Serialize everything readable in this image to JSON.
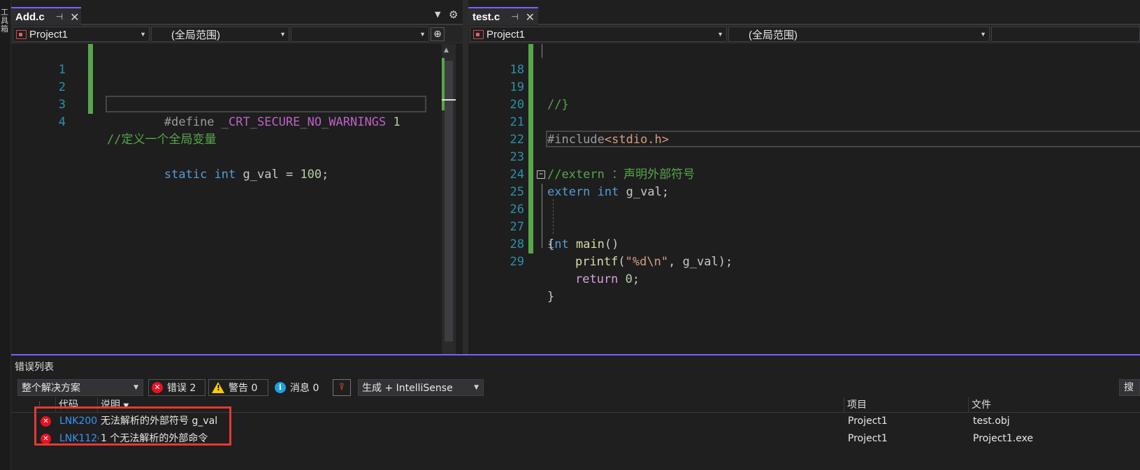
{
  "left_rail": {
    "text": "工具箱"
  },
  "left_editor": {
    "tab": {
      "title": "Add.c",
      "pin": "⊣",
      "close": "✕"
    },
    "nav": {
      "project": "Project1",
      "scope": "(全局范围)",
      "member": ""
    },
    "lines": [
      {
        "num": "1"
      },
      {
        "num": "2"
      },
      {
        "num": "3"
      },
      {
        "num": "4"
      }
    ],
    "code": {
      "l1_directive": "#define",
      "l1_macro": "_CRT_SECURE_NO_WARNINGS",
      "l1_value": "1",
      "l3_comment": "//定义一个全局变量",
      "l4_static": "static",
      "l4_int": "int",
      "l4_rest": "g_val =",
      "l4_num": "100",
      "l4_end": ";"
    }
  },
  "right_editor": {
    "tab": {
      "title": "test.c",
      "pin": "⊣",
      "close": "✕"
    },
    "nav": {
      "project": "Project1",
      "scope": "(全局范围)"
    },
    "lines": [
      {
        "num": "18"
      },
      {
        "num": "19"
      },
      {
        "num": "20"
      },
      {
        "num": "21"
      },
      {
        "num": "22"
      },
      {
        "num": "23"
      },
      {
        "num": "24"
      },
      {
        "num": "25"
      },
      {
        "num": "26"
      },
      {
        "num": "27"
      },
      {
        "num": "28"
      },
      {
        "num": "29"
      }
    ],
    "code": {
      "l18": "//}",
      "l20_inc": "#include",
      "l20_hdr": "<stdio.h>",
      "l22": "//extern ：声明外部符号",
      "l23_extern": "extern",
      "l23_int": "int",
      "l23_rest": "g_val;",
      "l25_int": "int",
      "l25_main": "main",
      "l25_paren": "()",
      "l26": "{",
      "l27_fn": "printf",
      "l27_open": "(",
      "l27_str": "\"%d\\n\"",
      "l27_rest": ", g_val);",
      "l28_ret": "return",
      "l28_num": "0",
      "l28_end": ";",
      "l29": "}"
    }
  },
  "error_list": {
    "title": "错误列表",
    "scope_filter": "整个解决方案",
    "errors_btn": "错误 2",
    "warnings_btn": "警告 0",
    "messages_btn": "消息 0",
    "build_filter": "生成 + IntelliSense",
    "search_stub": "搜",
    "columns": {
      "code": "代码",
      "desc": "说明",
      "project": "项目",
      "file": "文件"
    },
    "rows": [
      {
        "code": "LNK200",
        "desc": "无法解析的外部符号 g_val",
        "project": "Project1",
        "file": "test.obj"
      },
      {
        "code": "LNK112(",
        "desc": "1 个无法解析的外部命令",
        "project": "Project1",
        "file": "Project1.exe"
      }
    ]
  },
  "colors": {
    "accent": "#7b61ff",
    "error": "#e81123",
    "highlight": "#e53935",
    "gutter_change": "#57a64a"
  }
}
